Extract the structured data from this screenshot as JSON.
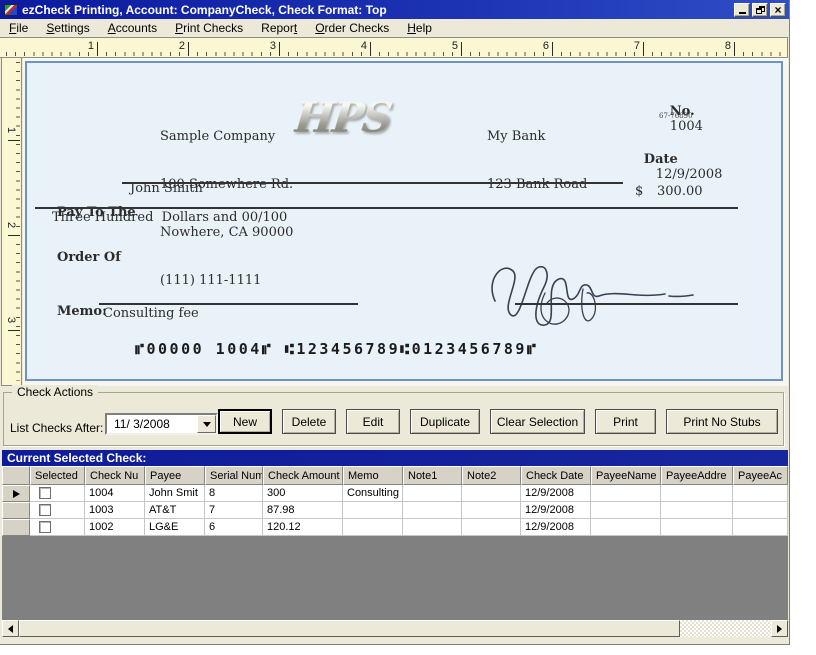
{
  "window": {
    "title": "ezCheck Printing, Account: CompanyCheck, Check Format: Top",
    "close_glyph": "×"
  },
  "menu": {
    "items": [
      {
        "pre": "",
        "key": "F",
        "post": "ile"
      },
      {
        "pre": "",
        "key": "S",
        "post": "ettings"
      },
      {
        "pre": "",
        "key": "A",
        "post": "ccounts"
      },
      {
        "pre": "",
        "key": "P",
        "post": "rint Checks"
      },
      {
        "pre": "Repor",
        "key": "t",
        "post": ""
      },
      {
        "pre": "",
        "key": "O",
        "post": "rder Checks"
      },
      {
        "pre": "",
        "key": "H",
        "post": "elp"
      }
    ]
  },
  "rulers": {
    "h": [
      "1",
      "2",
      "3",
      "4",
      "5",
      "6",
      "7",
      "8"
    ],
    "v": [
      "1",
      "2",
      "3"
    ]
  },
  "check": {
    "company": [
      "Sample Company",
      "100 Somewhere Rd.",
      "Nowhere, CA 90000",
      "(111) 111-1111"
    ],
    "logo": "HPS",
    "bank": [
      "My Bank",
      "123 Bank Road"
    ],
    "number_label": "No.",
    "number": "1004",
    "fraction": "67-76890",
    "date_label": "Date",
    "date": "12/9/2008",
    "pay_to_line1": "Pay To The",
    "pay_to_line2": "Order Of",
    "payee": "John Smith",
    "currency": "$",
    "amount": "300.00",
    "amount_words": "Three Hundred  Dollars and 00/100",
    "memo_label": "Memo:",
    "memo": "Consulting fee",
    "micr": "⑈00000 1004⑈ ⑆123456789⑆0123456789⑈"
  },
  "actions": {
    "group_label": "Check Actions",
    "filter_label": "List Checks After:",
    "date_value": "11/ 3/2008",
    "buttons": [
      "New",
      "Delete",
      "Edit",
      "Duplicate",
      "Clear Selection",
      "Print",
      "Print No Stubs"
    ]
  },
  "grid": {
    "caption": "Current Selected Check:",
    "columns": [
      "Selected",
      "Check Nu",
      "Payee",
      "Serial Num",
      "Check Amount",
      "Memo",
      "Note1",
      "Note2",
      "Check Date",
      "PayeeName",
      "PayeeAddre",
      "PayeeAc"
    ],
    "rows": [
      {
        "check_no": "1004",
        "payee": "John Smit",
        "serial": "8",
        "amount": "300",
        "memo": "Consulting",
        "note1": "",
        "note2": "",
        "date": "12/9/2008",
        "payee_name": "",
        "payee_addr": "",
        "payee_ac": ""
      },
      {
        "check_no": "1003",
        "payee": "AT&T",
        "serial": "7",
        "amount": "87.98",
        "memo": "",
        "note1": "",
        "note2": "",
        "date": "12/9/2008",
        "payee_name": "",
        "payee_addr": "",
        "payee_ac": ""
      },
      {
        "check_no": "1002",
        "payee": "LG&E",
        "serial": "6",
        "amount": "120.12",
        "memo": "",
        "note1": "",
        "note2": "",
        "date": "12/9/2008",
        "payee_name": "",
        "payee_addr": "",
        "payee_ac": ""
      }
    ]
  }
}
